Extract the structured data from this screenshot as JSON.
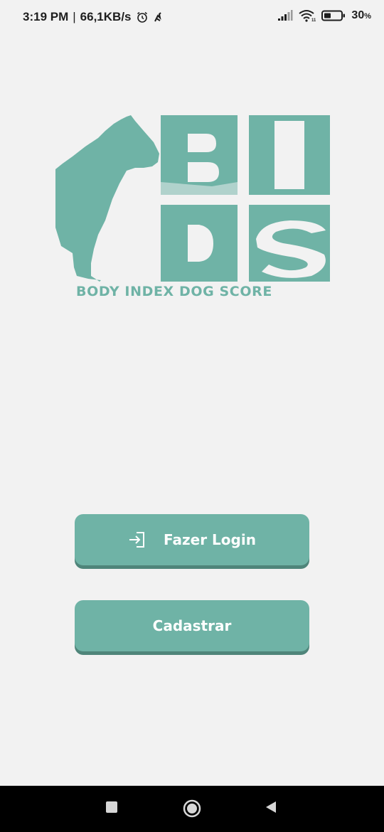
{
  "status_bar": {
    "time": "3:19 PM",
    "separator": "|",
    "speed": "66,1KB/s",
    "battery_percent": "30",
    "battery_unit": "%",
    "icons": [
      "alarm-icon",
      "app-notification-icon",
      "signal-icon",
      "wifi-icon",
      "battery-icon"
    ]
  },
  "logo": {
    "tagline": "BODY INDEX DOG SCORE",
    "color": "#6fb3a6"
  },
  "buttons": {
    "login_label": "Fazer Login",
    "login_icon": "login-icon",
    "register_label": "Cadastrar",
    "color": "#6fb3a6"
  },
  "navigation": {
    "icons": [
      "recent-apps-icon",
      "home-icon",
      "back-icon"
    ]
  }
}
